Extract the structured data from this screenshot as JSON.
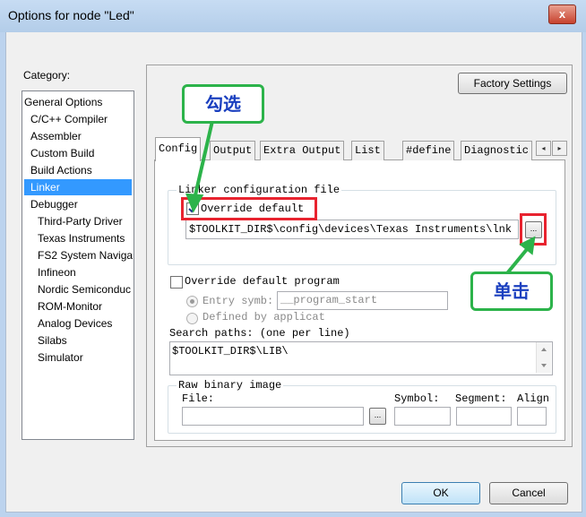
{
  "window": {
    "title": "Options for node \"Led\"",
    "close_glyph": "x"
  },
  "category": {
    "label": "Category:",
    "items": [
      {
        "label": "General Options"
      },
      {
        "label": "C/C++ Compiler"
      },
      {
        "label": "Assembler"
      },
      {
        "label": "Custom Build"
      },
      {
        "label": "Build Actions"
      },
      {
        "label": "Linker",
        "selected": true
      },
      {
        "label": "Debugger"
      },
      {
        "label": "Third-Party Driver"
      },
      {
        "label": "Texas Instruments"
      },
      {
        "label": "FS2 System Naviga"
      },
      {
        "label": "Infineon"
      },
      {
        "label": "Nordic Semiconduc"
      },
      {
        "label": "ROM-Monitor"
      },
      {
        "label": "Analog Devices"
      },
      {
        "label": "Silabs"
      },
      {
        "label": "Simulator"
      }
    ]
  },
  "factory_settings": "Factory Settings",
  "tabs": [
    "Config",
    "Output",
    "Extra Output",
    "List",
    "#define",
    "Diagnostic"
  ],
  "tab_scroll": {
    "left": "◂",
    "right": "▸"
  },
  "config": {
    "linker_group_label": "Linker configuration file",
    "override_default": "Override default",
    "linker_path": "$TOOLKIT_DIR$\\config\\devices\\Texas Instruments\\lnk",
    "browse": "...",
    "override_program": "Override default program",
    "entry_symbol": "Entry symb:",
    "entry_value": "__program_start",
    "defined_by": "Defined by applicat",
    "search_label": "Search paths:  (one per line)",
    "search_value": "$TOOLKIT_DIR$\\LIB\\",
    "raw_group": "Raw binary image",
    "file": "File:",
    "symbol": "Symbol:",
    "segment": "Segment:",
    "align": "Align"
  },
  "buttons": {
    "ok": "OK",
    "cancel": "Cancel"
  },
  "annotations": {
    "check": "勾选",
    "click": "单击"
  },
  "colors": {
    "highlight": "#e8232f",
    "callout_border": "#2cb34a",
    "callout_text": "#1a3fbf",
    "selection": "#3399ff"
  }
}
